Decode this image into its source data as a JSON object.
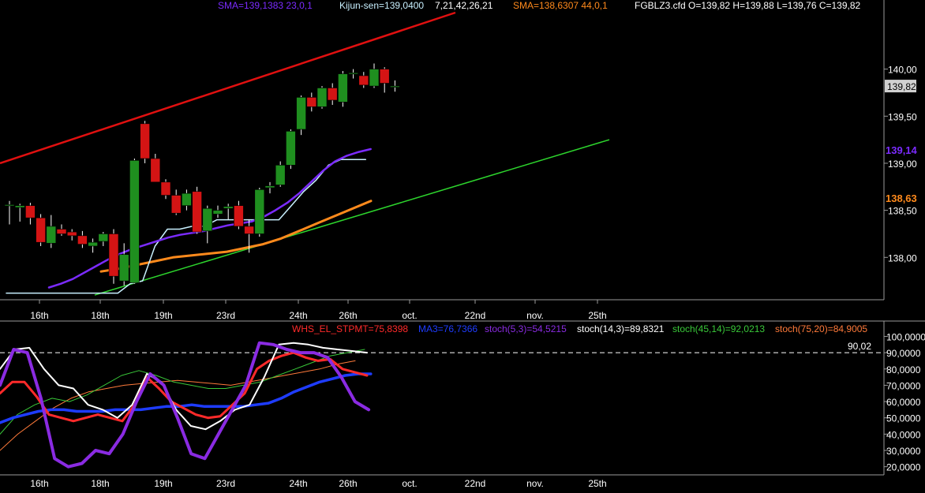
{
  "header": {
    "sma_purple": "SMA=139,1383  23,0,1",
    "kijun": "Kijun-sen=139,0400",
    "ichimoku_params": "7,21,42,26,21",
    "sma_orange": "SMA=138,6307  44,0,1",
    "ohlc": "FGBLZ3.cfd O=139,82 H=139,88 L=139,76 C=139,82"
  },
  "indicator_header": {
    "whs": "WHS_EL_STPMT=75,8398",
    "ma": "MA3=76,7366",
    "stoch_5_3": "stoch(5,3)=54,5215",
    "stoch_14_3": "stoch(14,3)=89,8321",
    "stoch_45_14": "stoch(45,14)=92,0213",
    "stoch_75_20": "stoch(75,20)=84,9005"
  },
  "price_badges": {
    "last": "139,82",
    "sma_purple": "139,14",
    "sma_orange": "138,63",
    "stoch_level": "90,02"
  },
  "colors": {
    "background": "#000000",
    "bull": "#1f8f1f",
    "bear": "#d41414",
    "sma_purple": "#7b2bff",
    "kijun": "#c8f0ff",
    "sma_orange": "#ff8a1c",
    "trend_red": "#e01010",
    "trend_green": "#2dd52d",
    "whs": "#ff2a2a",
    "ma3": "#1e3cff",
    "stoch_5_3": "#8a2be2",
    "stoch_14_3": "#ffffff",
    "stoch_45_14": "#39c839",
    "stoch_75_20": "#ff7a3a"
  },
  "chart_data": [
    {
      "type": "candlestick",
      "symbol": "FGBLZ3.cfd",
      "ylim": [
        137.55,
        140.6
      ],
      "y_ticks": [
        "140,00",
        "139,50",
        "139,00",
        "138,50",
        "138,00"
      ],
      "x_ticks": [
        "16th",
        "18th",
        "19th",
        "23rd",
        "24th",
        "26th",
        "oct.",
        "22nd",
        "nov.",
        "25th"
      ],
      "candles": [
        {
          "o": 138.55,
          "h": 138.6,
          "l": 138.35,
          "c": 138.56
        },
        {
          "o": 138.53,
          "h": 138.57,
          "l": 138.38,
          "c": 138.55
        },
        {
          "o": 138.55,
          "h": 138.58,
          "l": 138.35,
          "c": 138.42
        },
        {
          "o": 138.42,
          "h": 138.46,
          "l": 138.12,
          "c": 138.16
        },
        {
          "o": 138.15,
          "h": 138.45,
          "l": 138.1,
          "c": 138.33
        },
        {
          "o": 138.3,
          "h": 138.35,
          "l": 138.23,
          "c": 138.25
        },
        {
          "o": 138.27,
          "h": 138.3,
          "l": 138.18,
          "c": 138.23
        },
        {
          "o": 138.23,
          "h": 138.28,
          "l": 138.1,
          "c": 138.14
        },
        {
          "o": 138.12,
          "h": 138.2,
          "l": 138.05,
          "c": 138.16
        },
        {
          "o": 138.17,
          "h": 138.27,
          "l": 138.12,
          "c": 138.25
        },
        {
          "o": 138.25,
          "h": 138.3,
          "l": 137.72,
          "c": 137.8
        },
        {
          "o": 137.75,
          "h": 138.15,
          "l": 137.7,
          "c": 138.03
        },
        {
          "o": 137.73,
          "h": 139.05,
          "l": 137.72,
          "c": 139.03
        },
        {
          "o": 139.42,
          "h": 139.45,
          "l": 139.0,
          "c": 139.05
        },
        {
          "o": 139.05,
          "h": 139.1,
          "l": 138.8,
          "c": 138.8
        },
        {
          "o": 138.8,
          "h": 138.83,
          "l": 138.62,
          "c": 138.66
        },
        {
          "o": 138.66,
          "h": 138.72,
          "l": 138.45,
          "c": 138.47
        },
        {
          "o": 138.55,
          "h": 138.72,
          "l": 138.5,
          "c": 138.68
        },
        {
          "o": 138.7,
          "h": 138.75,
          "l": 138.25,
          "c": 138.27
        },
        {
          "o": 138.28,
          "h": 138.55,
          "l": 138.15,
          "c": 138.52
        },
        {
          "o": 138.46,
          "h": 138.55,
          "l": 138.42,
          "c": 138.5
        },
        {
          "o": 138.52,
          "h": 138.57,
          "l": 138.4,
          "c": 138.54
        },
        {
          "o": 138.55,
          "h": 138.6,
          "l": 138.3,
          "c": 138.33
        },
        {
          "o": 138.33,
          "h": 138.4,
          "l": 138.05,
          "c": 138.25
        },
        {
          "o": 138.25,
          "h": 138.74,
          "l": 138.22,
          "c": 138.72
        },
        {
          "o": 138.74,
          "h": 138.8,
          "l": 138.68,
          "c": 138.76
        },
        {
          "o": 138.77,
          "h": 139.02,
          "l": 138.75,
          "c": 138.98
        },
        {
          "o": 138.98,
          "h": 139.36,
          "l": 138.94,
          "c": 139.34
        },
        {
          "o": 139.36,
          "h": 139.72,
          "l": 139.3,
          "c": 139.7
        },
        {
          "o": 139.7,
          "h": 139.75,
          "l": 139.55,
          "c": 139.6
        },
        {
          "o": 139.6,
          "h": 139.82,
          "l": 139.58,
          "c": 139.8
        },
        {
          "o": 139.8,
          "h": 139.85,
          "l": 139.62,
          "c": 139.67
        },
        {
          "o": 139.65,
          "h": 139.98,
          "l": 139.6,
          "c": 139.95
        },
        {
          "o": 139.95,
          "h": 140.0,
          "l": 139.9,
          "c": 139.96
        },
        {
          "o": 139.93,
          "h": 139.97,
          "l": 139.8,
          "c": 139.83
        },
        {
          "o": 139.82,
          "h": 140.06,
          "l": 139.8,
          "c": 140.0
        },
        {
          "o": 140.0,
          "h": 140.02,
          "l": 139.75,
          "c": 139.85
        },
        {
          "o": 139.82,
          "h": 139.88,
          "l": 139.76,
          "c": 139.82
        }
      ],
      "series": [
        {
          "name": "SMA 23",
          "values": [
            137.68,
            137.72,
            137.77,
            137.84,
            137.91,
            137.98,
            138.04,
            138.09,
            138.13,
            138.17,
            138.21,
            138.24,
            138.26,
            138.28,
            138.31,
            138.34,
            138.36,
            138.38,
            138.43,
            138.5,
            138.58,
            138.68,
            138.8,
            138.92,
            139.02,
            139.08,
            139.12,
            139.15
          ]
        },
        {
          "name": "Kijun-sen",
          "values": [
            137.62,
            137.62,
            137.62,
            137.62,
            137.62,
            137.62,
            137.62,
            137.62,
            137.62,
            137.62,
            137.72,
            137.75,
            138.12,
            138.3,
            138.3,
            138.33,
            138.33,
            138.4,
            138.4,
            138.4,
            138.4,
            138.4,
            138.4,
            138.55,
            138.7,
            138.82,
            138.98,
            139.04,
            139.04,
            139.04
          ]
        },
        {
          "name": "SMA 44",
          "values": [
            137.85,
            137.88,
            137.92,
            137.96,
            138.0,
            138.02,
            138.04,
            138.06,
            138.1,
            138.14,
            138.2,
            138.28,
            138.36,
            138.44,
            138.52,
            138.6
          ]
        },
        {
          "name": "Trend up",
          "values": [
            139.0,
            140.6
          ]
        },
        {
          "name": "Trend channel",
          "values": [
            137.6,
            139.25
          ]
        }
      ]
    },
    {
      "type": "line",
      "ylim": [
        15,
        107
      ],
      "y_ticks": [
        "100,0000",
        "90,0000",
        "80,0000",
        "70,0000",
        "60,0000",
        "50,0000",
        "40,0000",
        "30,0000",
        "20,0000"
      ],
      "x_ticks": [
        "16th",
        "18th",
        "19th",
        "23rd",
        "24th",
        "26th",
        "oct.",
        "22nd",
        "nov.",
        "25th"
      ],
      "series": [
        {
          "name": "WHS_EL_STPMT",
          "values": [
            65,
            72,
            72,
            63,
            52,
            50,
            48,
            50,
            52,
            50,
            48,
            58,
            75,
            68,
            60,
            56,
            52,
            50,
            51,
            58,
            65,
            80,
            85,
            88,
            90,
            87,
            85,
            86,
            80,
            78,
            76
          ]
        },
        {
          "name": "MA3",
          "values": [
            47,
            50,
            52,
            54,
            55,
            55,
            54,
            54,
            54,
            55,
            55,
            55,
            56,
            57,
            57,
            58,
            57,
            57,
            57,
            57,
            58,
            59,
            62,
            66,
            69,
            72,
            74,
            76,
            77,
            77
          ]
        },
        {
          "name": "stoch(5,3)",
          "values": [
            70,
            92,
            90,
            62,
            25,
            20,
            22,
            30,
            28,
            40,
            60,
            77,
            70,
            50,
            28,
            25,
            40,
            55,
            70,
            96,
            95,
            92,
            90,
            90,
            87,
            75,
            60,
            55
          ]
        },
        {
          "name": "stoch(14,3)",
          "values": [
            80,
            92,
            93,
            80,
            70,
            68,
            58,
            55,
            50,
            58,
            77,
            72,
            55,
            45,
            43,
            48,
            55,
            58,
            75,
            95,
            96,
            95,
            93,
            92,
            91,
            90
          ]
        },
        {
          "name": "stoch(45,14)",
          "values": [
            40,
            52,
            58,
            62,
            60,
            64,
            70,
            76,
            79,
            76,
            72,
            70,
            68,
            68,
            70,
            72,
            76,
            80,
            84,
            88,
            90,
            92
          ]
        },
        {
          "name": "stoch(75,20)",
          "values": [
            30,
            40,
            48,
            56,
            62,
            66,
            68,
            70,
            71,
            72,
            73,
            72,
            71,
            70,
            72,
            74,
            76,
            78,
            80,
            83,
            85
          ]
        }
      ],
      "reference_line": 90.02
    }
  ]
}
